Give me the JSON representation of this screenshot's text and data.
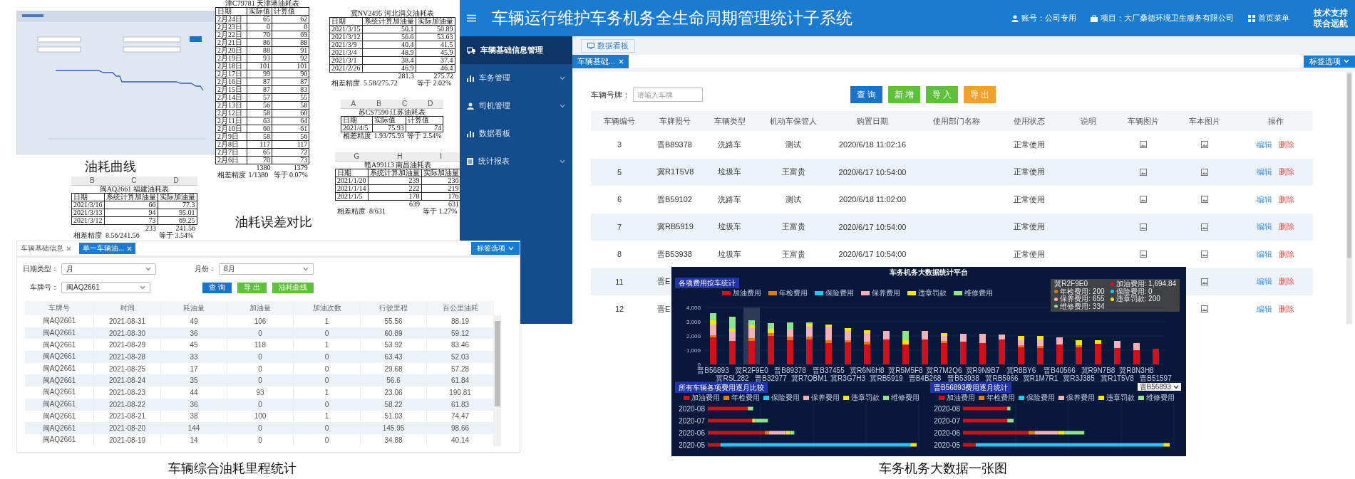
{
  "fuel_curve": {
    "caption": "油耗曲线"
  },
  "spreadsheets": [
    {
      "title": "津C79781 天津港油耗表",
      "header": [
        "日期",
        "实际值",
        "计算值"
      ],
      "rows": [
        [
          "2月24日",
          "65",
          "62"
        ],
        [
          "2月23日",
          "0",
          "0"
        ],
        [
          "2月22日",
          "70",
          "69"
        ],
        [
          "2月21日",
          "86",
          "88"
        ],
        [
          "2月20日",
          "88",
          "91"
        ],
        [
          "2月19日",
          "93",
          "92"
        ],
        [
          "2月18日",
          "101",
          "101"
        ],
        [
          "2月17日",
          "99",
          "90"
        ],
        [
          "2月16日",
          "87",
          "87"
        ],
        [
          "2月15日",
          "87",
          "83"
        ],
        [
          "2月14日",
          "57",
          "55"
        ],
        [
          "2月13日",
          "56",
          "58"
        ],
        [
          "2月12日",
          "58",
          "60"
        ],
        [
          "2月11日",
          "63",
          "64"
        ],
        [
          "2月10日",
          "60",
          "61"
        ],
        [
          "2月9日",
          "58",
          "56"
        ],
        [
          "2月8日",
          "117",
          "117"
        ],
        [
          "2月7日",
          "65",
          "72"
        ],
        [
          "2月6日",
          "70",
          "73"
        ]
      ],
      "totals": [
        "1380",
        "1379"
      ],
      "precision": [
        "相差精度",
        "1/1380",
        "等于 0.07%"
      ]
    },
    {
      "title": "冀NV2495 河北润义油耗表",
      "header": [
        "日期",
        "系统计算加油量",
        "实际加油量"
      ],
      "rows": [
        [
          "2021/3/15",
          "50.1",
          "50.89"
        ],
        [
          "2021/3/12",
          "56.6",
          "53.63"
        ],
        [
          "2021/3/9",
          "40.4",
          "41.5"
        ],
        [
          "2021/3/4",
          "48.9",
          "45.9"
        ],
        [
          "2021/3/1",
          "38.4",
          "37.4"
        ],
        [
          "2021/2/26",
          "46.9",
          "46.4"
        ]
      ],
      "totals": [
        "281.3",
        "275.72"
      ],
      "precision": [
        "相差精度",
        "5.58/275.72",
        "等于 2.02%"
      ]
    },
    {
      "column_letters": [
        "A",
        "B",
        "C",
        "D"
      ],
      "title": "苏CS7590 江苏油耗表",
      "header": [
        "日期",
        "实际值",
        "计算值"
      ],
      "rows": [
        [
          "2021/4/5",
          "75.93",
          "74"
        ]
      ],
      "precision": [
        "相差精度",
        "1.93/75.93",
        "等于 2.54%"
      ]
    },
    {
      "column_letters": [
        "B",
        "C",
        "D"
      ],
      "title": "闽AQ2661 福建油耗表",
      "header": [
        "日期",
        "系统计算加油量",
        "实际加油量"
      ],
      "rows": [
        [
          "2021/3/16",
          "66",
          "77.3"
        ],
        [
          "2021/3/13",
          "94",
          "95.01"
        ],
        [
          "2021/3/12",
          "73",
          "69.25"
        ]
      ],
      "totals": [
        "233",
        "241.56"
      ],
      "precision": [
        "相差精度",
        "8.56/241.56",
        "等于 3.54%"
      ]
    },
    {
      "column_letters": [
        "G",
        "H",
        "I"
      ],
      "title": "赣A99113 南昌油耗表",
      "header": [
        "日期",
        "系统计算加油量",
        "实际加油量"
      ],
      "rows": [
        [
          "2021/1/20",
          "239",
          "236"
        ],
        [
          "2021/1/14",
          "222",
          "219"
        ],
        [
          "2021/1/5",
          "178",
          "176"
        ]
      ],
      "totals": [
        "639",
        "631"
      ],
      "precision": [
        "相差精度",
        "8/631",
        "等于 1.27%"
      ]
    }
  ],
  "spreadsheet_caption": "油耗误差对比",
  "main_system": {
    "title": "车辆运行维护车务机务全生命周期管理统计子系统",
    "account": "账号：公司专用",
    "project": "项目：大厂桑德环境卫生服务有限公司",
    "home_menu": "首页菜单",
    "support": [
      "技术支持",
      "联合远航"
    ],
    "sidebar": [
      {
        "label": "车辆基础信息管理",
        "selected": true,
        "has_submenu": false
      },
      {
        "label": "车务管理",
        "selected": false,
        "has_submenu": true
      },
      {
        "label": "司机管理",
        "selected": false,
        "has_submenu": true
      },
      {
        "label": "数据看板",
        "selected": false,
        "has_submenu": false
      },
      {
        "label": "统计报表",
        "selected": false,
        "has_submenu": true
      }
    ],
    "board_tab": "数据看板",
    "tabs": [
      {
        "label": "车辆基础...",
        "selected": true
      }
    ],
    "tab_options": "标签选项",
    "search": {
      "label": "车辆号牌：",
      "placeholder": "请输入车牌"
    },
    "buttons": [
      {
        "label": "查 询",
        "kind": "primary"
      },
      {
        "label": "新 增",
        "kind": "success"
      },
      {
        "label": "导 入",
        "kind": "success"
      },
      {
        "label": "导 出",
        "kind": "warning"
      }
    ],
    "columns": [
      "车辆编号",
      "车牌照号",
      "车辆类型",
      "机动车保管人",
      "购置日期",
      "使用部门名称",
      "使用状态",
      "说明",
      "车辆图片",
      "车本图片",
      "操作"
    ],
    "rows": [
      {
        "no": "3",
        "plate": "晋B89378",
        "type": "洗路车",
        "keeper": "测试",
        "date": "2020/6/18 11:02:16",
        "status": "正常使用",
        "vehicle_photo": true,
        "license_photo": true,
        "actions": [
          "编辑",
          "删除"
        ]
      },
      {
        "no": "5",
        "plate": "冀R1T5V8",
        "type": "垃圾车",
        "keeper": "王富贵",
        "date": "2020/6/17 10:54:00",
        "status": "正常使用",
        "vehicle_photo": true,
        "license_photo": true,
        "actions": [
          "编辑",
          "删除"
        ]
      },
      {
        "no": "6",
        "plate": "晋B59102",
        "type": "洗路车",
        "keeper": "测试",
        "date": "2020/6/18 11:02:00",
        "status": "正常使用",
        "vehicle_photo": true,
        "license_photo": true,
        "actions": [
          "编辑",
          "删除"
        ]
      },
      {
        "no": "7",
        "plate": "冀RB5919",
        "type": "垃圾车",
        "keeper": "王富贵",
        "date": "2020/6/17 10:54:00",
        "status": "正常使用",
        "vehicle_photo": true,
        "license_photo": true,
        "actions": [
          "编辑",
          "删除"
        ]
      },
      {
        "no": "8",
        "plate": "晋B53938",
        "type": "垃圾车",
        "keeper": "王富贵",
        "date": "2020/6/17 10:54:00",
        "status": "正常使用",
        "vehicle_photo": true,
        "license_photo": true,
        "actions": [
          "编辑",
          "删除"
        ]
      },
      {
        "no": "11",
        "plate": "晋E",
        "license_photo": true,
        "actions": [
          "编辑",
          "删除"
        ]
      },
      {
        "no": "12",
        "plate": "晋E",
        "license_photo": true,
        "actions": [
          "编辑",
          "删除"
        ]
      }
    ]
  },
  "fuel_stats": {
    "tabs": [
      {
        "label": "车辆基础信息",
        "selected": false
      },
      {
        "label": "单一车辆油...",
        "selected": true
      }
    ],
    "tab_options": "标签选项",
    "filters": [
      {
        "label": "日期类型：",
        "value": "月"
      },
      {
        "label": "月份：",
        "value": "8月"
      },
      {
        "label": "车牌号：",
        "value": "闽AQ2661"
      }
    ],
    "buttons": [
      {
        "label": "查 询",
        "kind": "primary"
      },
      {
        "label": "导 出",
        "kind": "success"
      },
      {
        "label": "油耗曲线",
        "kind": "success"
      }
    ],
    "columns": [
      "车牌号",
      "时间",
      "耗油量",
      "加油量",
      "加油次数",
      "行驶里程",
      "百公里油耗"
    ],
    "rows": [
      [
        "闽AQ2661",
        "2021-08-31",
        "49",
        "106",
        "1",
        "55.56",
        "88.19"
      ],
      [
        "闽AQ2661",
        "2021-08-30",
        "36",
        "0",
        "0",
        "60.89",
        "59.12"
      ],
      [
        "闽AQ2661",
        "2021-08-29",
        "45",
        "118",
        "1",
        "53.92",
        "83.46"
      ],
      [
        "闽AQ2661",
        "2021-08-28",
        "33",
        "0",
        "0",
        "63.43",
        "52.03"
      ],
      [
        "闽AQ2661",
        "2021-08-25",
        "17",
        "0",
        "0",
        "29.68",
        "57.28"
      ],
      [
        "闽AQ2661",
        "2021-08-24",
        "35",
        "0",
        "0",
        "56.6",
        "61.84"
      ],
      [
        "闽AQ2661",
        "2021-08-23",
        "44",
        "93",
        "1",
        "23.06",
        "190.81"
      ],
      [
        "闽AQ2661",
        "2021-08-22",
        "36",
        "0",
        "0",
        "58.22",
        "61.83"
      ],
      [
        "闽AQ2661",
        "2021-08-21",
        "38",
        "100",
        "1",
        "51.03",
        "74.47"
      ],
      [
        "闽AQ2661",
        "2021-08-20",
        "144",
        "0",
        "0",
        "145.95",
        "98.66"
      ],
      [
        "闽AQ2661",
        "2021-08-19",
        "14",
        "0",
        "0",
        "34.88",
        "40.14"
      ]
    ],
    "caption": "车辆综合油耗里程统计"
  },
  "dashboard": {
    "title": "车务机务大数据统计平台",
    "top_panel": {
      "title": "各项费用按车统计",
      "chart_data": {
        "type": "bar",
        "stacked": true,
        "grid": true,
        "ylim": [
          0,
          4000
        ],
        "categories": [
          "晋B56893",
          "冀RSL282",
          "冀R2F9E0",
          "晋B32977",
          "晋B89378",
          "冀R7QBM1",
          "晋B37455",
          "冀R3G7H3",
          "冀R6N6H8",
          "冀RB5919",
          "冀R5M5F8",
          "晋B4B268",
          "冀R7M2Q6",
          "晋B53938",
          "冀R9N9B7",
          "冀RB5966",
          "冀R8BY6",
          "冀R1M7R1",
          "晋B40566",
          "冀R3J385",
          "冀R9N7B8",
          "冀R1T5V8",
          "冀R8N3H8",
          "晋B51597"
        ],
        "yticks": [
          {
            "value": 0,
            "label": "0"
          },
          {
            "value": 1000,
            "label": "1,000"
          },
          {
            "value": 2000,
            "label": "2,000"
          },
          {
            "value": 3000,
            "label": "3,000"
          },
          {
            "value": 4000,
            "label": "4,000"
          }
        ],
        "series": [
          {
            "name": "加油费用",
            "color": "#d0111b",
            "values": [
              1900,
              1650,
              1650,
              2000,
              1700,
              1750,
              1500,
              1550,
              1400,
              1750,
              1350,
              1750,
              1500,
              1600,
              1500,
              1750,
              1200,
              1150,
              1400,
              1200,
              1450,
              1150,
              1000,
              1100
            ]
          },
          {
            "name": "年检费用",
            "color": "#e07b12",
            "values": [
              150,
              0,
              200,
              200,
              250,
              200,
              200,
              150,
              200,
              0,
              100,
              0,
              150,
              0,
              0,
              0,
              150,
              150,
              0,
              150,
              0,
              0,
              0,
              0
            ]
          },
          {
            "name": "保险费用",
            "color": "#1ec8f0",
            "values": [
              0,
              0,
              0,
              0,
              0,
              0,
              0,
              0,
              0,
              0,
              0,
              0,
              0,
              0,
              0,
              0,
              0,
              0,
              0,
              0,
              0,
              0,
              0,
              0
            ]
          },
          {
            "name": "保养费用",
            "color": "#f3b0b8",
            "values": [
              750,
              650,
              700,
              0,
              500,
              700,
              950,
              650,
              600,
              600,
              0,
              600,
              350,
              550,
              650,
              350,
              350,
              450,
              500,
              0,
              0,
              500,
              500,
              0
            ]
          },
          {
            "name": "违章罚款",
            "color": "#f5e50e",
            "values": [
              300,
              200,
              200,
              300,
              0,
              200,
              150,
              200,
              200,
              0,
              250,
              0,
              200,
              0,
              0,
              0,
              300,
              250,
              0,
              350,
              250,
              0,
              0,
              0
            ]
          },
          {
            "name": "维修费用",
            "color": "#8ee38e",
            "values": [
              500,
              850,
              350,
              400,
              500,
              100,
              0,
              0,
              0,
              0,
              650,
              0,
              0,
              0,
              0,
              0,
              0,
              0,
              0,
              0,
              0,
              0,
              0,
              0
            ]
          }
        ]
      },
      "tooltip": {
        "title": "冀R2F9E0",
        "lines": [
          {
            "text": "加油费用: 1,694.84",
            "color": "#d0111b"
          },
          {
            "text": "年检费用: 200",
            "color": "#e07b12"
          },
          {
            "text": "保险费用: 0",
            "color": "#1ec8f0"
          },
          {
            "text": "保养费用: 655",
            "color": "#f3b0b8"
          },
          {
            "text": "违章罚款: 200",
            "color": "#f5e50e"
          },
          {
            "text": "维修费用: 334",
            "color": "#8ee38e"
          }
        ]
      }
    },
    "bottom_panels": [
      {
        "title": "所有车辆各项费用逐月比较",
        "legend": [
          {
            "label": "加油费用",
            "color": "#d0111b"
          },
          {
            "label": "年检费用",
            "color": "#e07b12"
          },
          {
            "label": "保险费用",
            "color": "#1ec8f0"
          },
          {
            "label": "保养费用",
            "color": "#f3b0b8"
          },
          {
            "label": "违章罚款",
            "color": "#f5e50e"
          },
          {
            "label": "维修费用",
            "color": "#8ee38e"
          }
        ],
        "months": [
          "2020-08",
          "2020-07",
          "2020-06",
          "2020-05"
        ]
      },
      {
        "title": "晋B56893费用逐月统计",
        "selector": "晋B56893",
        "legend": [
          {
            "label": "加油费用",
            "color": "#d0111b"
          },
          {
            "label": "年检费用",
            "color": "#e07b12"
          },
          {
            "label": "保险费用",
            "color": "#1ec8f0"
          },
          {
            "label": "保养费用",
            "color": "#f3b0b8"
          },
          {
            "label": "违章罚款",
            "color": "#f5e50e"
          },
          {
            "label": "维修费用",
            "color": "#8ee38e"
          }
        ],
        "months": [
          "2020-08",
          "2020-07",
          "2020-06",
          "2020-05"
        ]
      }
    ],
    "caption": "车务机务大数据一张图"
  }
}
